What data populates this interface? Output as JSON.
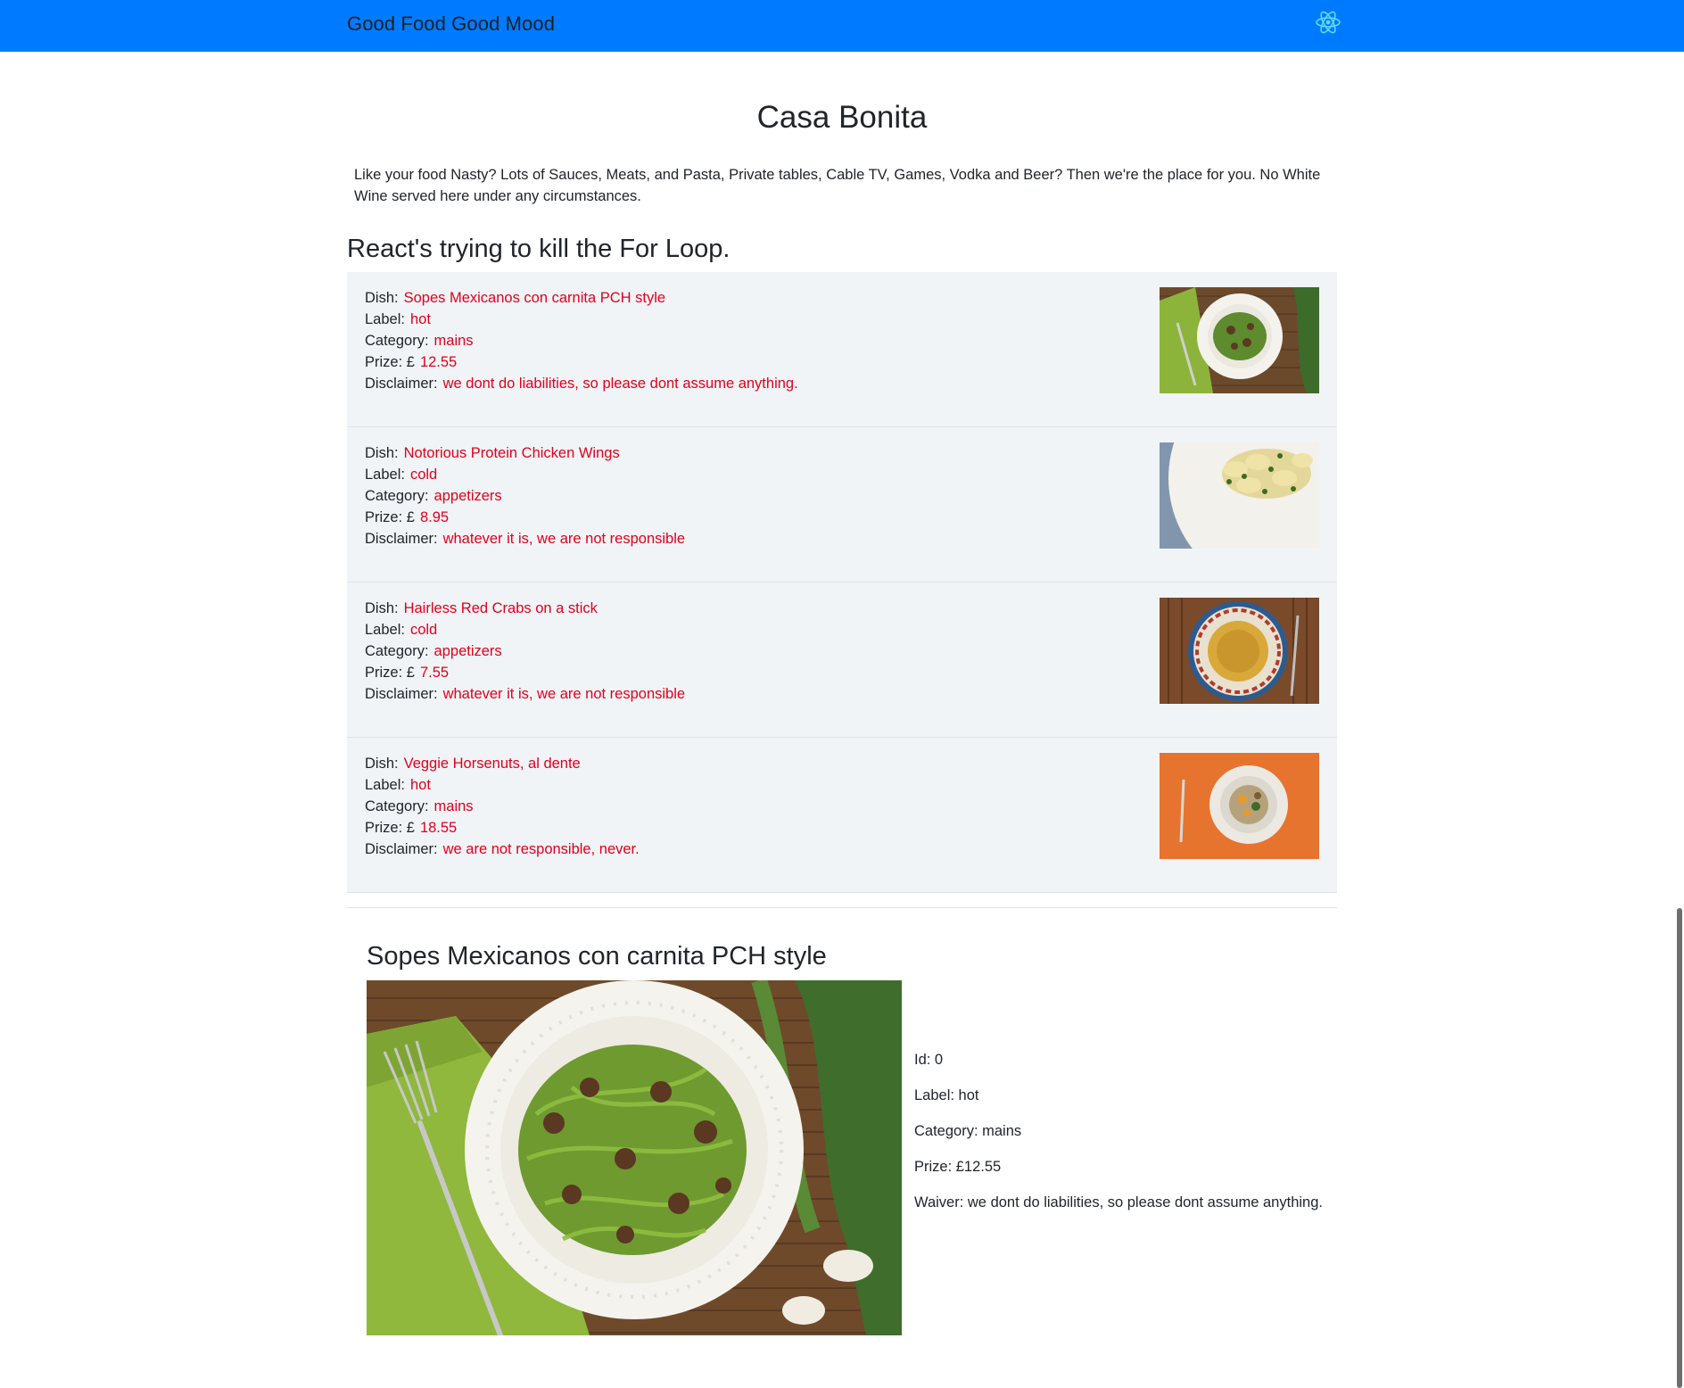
{
  "navbar": {
    "brand": "Good Food Good Mood",
    "logo_icon": "react-atom-icon",
    "accent": "#007bff"
  },
  "page": {
    "title": "Casa Bonita",
    "description": "Like your food Nasty? Lots of Sauces, Meats, and Pasta, Private tables, Cable TV, Games, Vodka and Beer? Then we're the place for you. No White Wine served here under any circumstances.",
    "section_heading": "React's trying to kill the For Loop."
  },
  "labels": {
    "dish": "Dish:",
    "label": "Label:",
    "category": "Category:",
    "prize": "Prize: £",
    "disclaimer": "Disclaimer:"
  },
  "menu_items": [
    {
      "dish": "Sopes Mexicanos con carnita PCH style",
      "label": "hot",
      "category": "mains",
      "prize": "12.55",
      "disclaimer": "we dont do liabilities, so please dont assume anything.",
      "image": "green-noodles-with-mushrooms-photo"
    },
    {
      "dish": "Notorious Protein Chicken Wings",
      "label": "cold",
      "category": "appetizers",
      "prize": "8.95",
      "disclaimer": "whatever it is, we are not responsible",
      "image": "tortellini-with-herbs-photo"
    },
    {
      "dish": "Hairless Red Crabs on a stick",
      "label": "cold",
      "category": "appetizers",
      "prize": "7.55",
      "disclaimer": "whatever it is, we are not responsible",
      "image": "spaghetti-on-patterned-plate-photo"
    },
    {
      "dish": "Veggie Horsenuts, al dente",
      "label": "hot",
      "category": "mains",
      "prize": "18.55",
      "disclaimer": "we are not responsible, never.",
      "image": "veggie-bowl-on-orange-photo"
    }
  ],
  "detail": {
    "title": "Sopes Mexicanos con carnita PCH style",
    "image": "green-noodles-with-mushrooms-photo",
    "id_line": "Id: 0",
    "label_line": "Label: hot",
    "category_line": "Category: mains",
    "prize_line": "Prize: £12.55",
    "waiver_line": "Waiver: we dont do liabilities, so please dont assume anything."
  },
  "colors": {
    "value_text": "#e0001a",
    "list_background": "#f1f4f7"
  }
}
